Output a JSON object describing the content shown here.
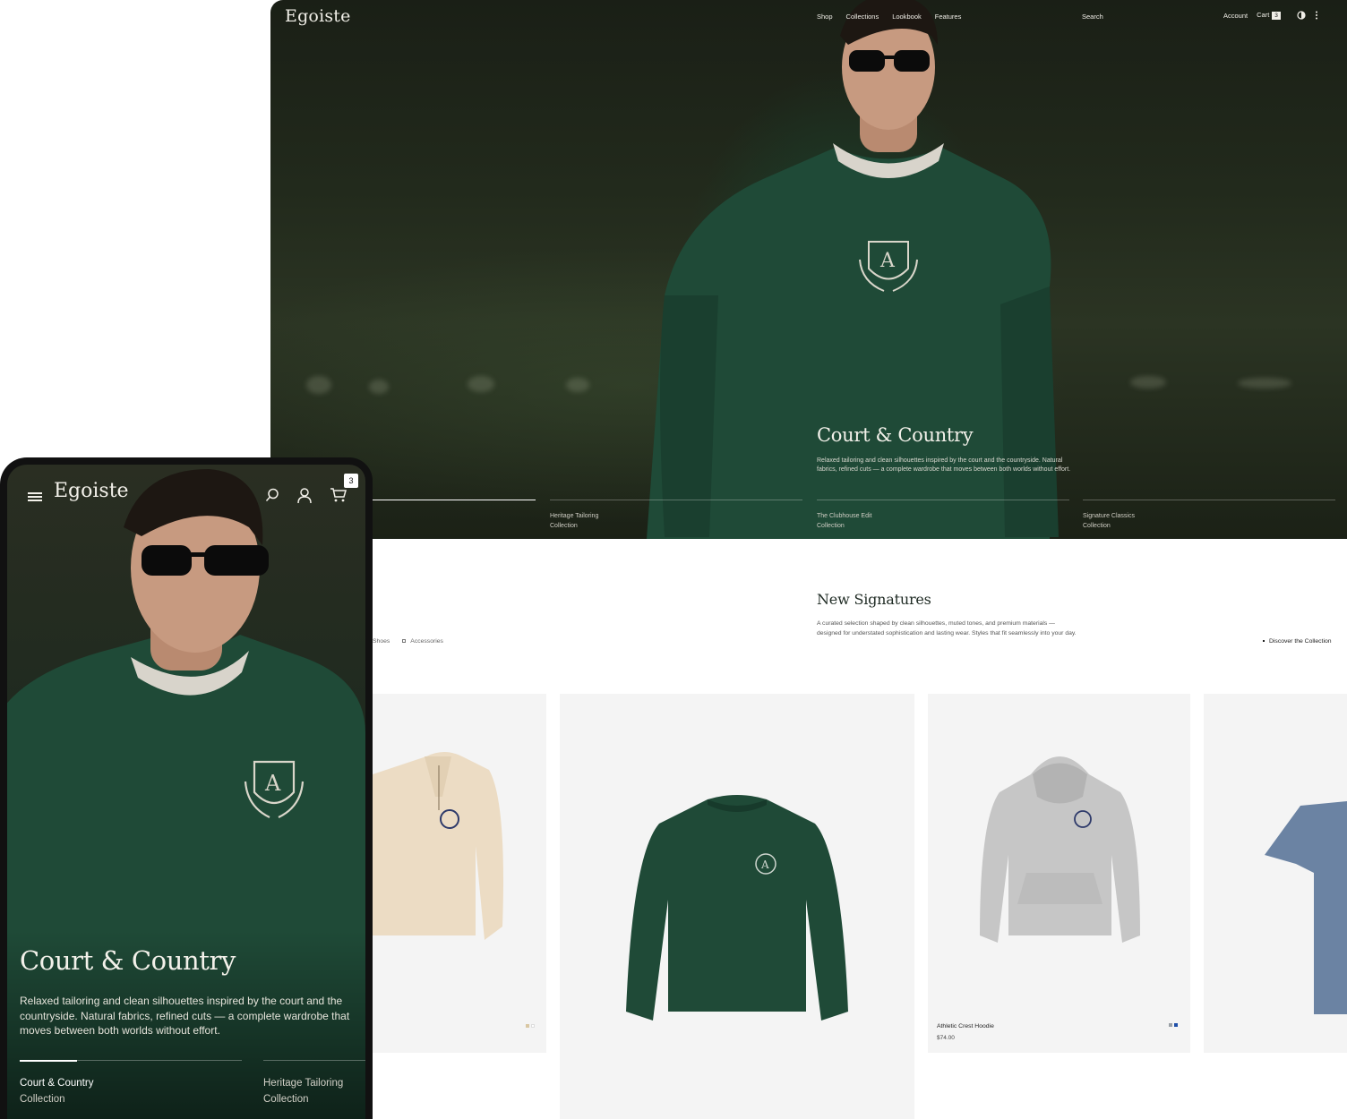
{
  "desktop": {
    "nav": {
      "logo": "Egoiste",
      "links": [
        "Shop",
        "Collections",
        "Lookbook",
        "Features"
      ],
      "search": "Search",
      "account": "Account",
      "cart_label": "Cart",
      "cart_count": "3"
    },
    "hero": {
      "title": "Court & Country",
      "description": "Relaxed tailoring and clean silhouettes inspired by the court and the countryside. Natural fabrics, refined cuts — a complete wardrobe that moves between both worlds without effort.",
      "tabs": [
        {
          "line1": "Heritage Tailoring",
          "line2": "Collection"
        },
        {
          "line1": "The Clubhouse Edit",
          "line2": "Collection"
        },
        {
          "line1": "Signature Classics",
          "line2": "Collection"
        }
      ]
    },
    "section": {
      "title": "New Signatures",
      "description": "A curated selection shaped by clean silhouettes, muted tones, and premium materials — designed for understated sophistication and lasting wear. Styles that fit seamlessly into your day.",
      "filters": [
        "Shoes",
        "Accessories"
      ],
      "discover": "Discover the Collection"
    },
    "products": [
      {
        "name": "Athletic Crest Hoodie",
        "price": "$74.00",
        "swatches": [
          "#9aa0a6",
          "#1f4fa8"
        ]
      }
    ],
    "swatch_colors": {
      "cream": "#d9c7a3",
      "green": "#1f4a37",
      "grey": "#c9c9c9",
      "blue": "#6b83a3"
    }
  },
  "mobile": {
    "logo": "Egoiste",
    "cart_count": "3",
    "hero": {
      "title": "Court & Country",
      "description": "Relaxed tailoring and clean silhouettes inspired by the court and the countryside. Natural fabrics, refined cuts — a complete wardrobe that moves between both worlds without effort.",
      "tabs": [
        {
          "line1": "Court & Country",
          "line2": "Collection"
        },
        {
          "line1": "Heritage Tailoring",
          "line2": "Collection"
        }
      ]
    }
  }
}
